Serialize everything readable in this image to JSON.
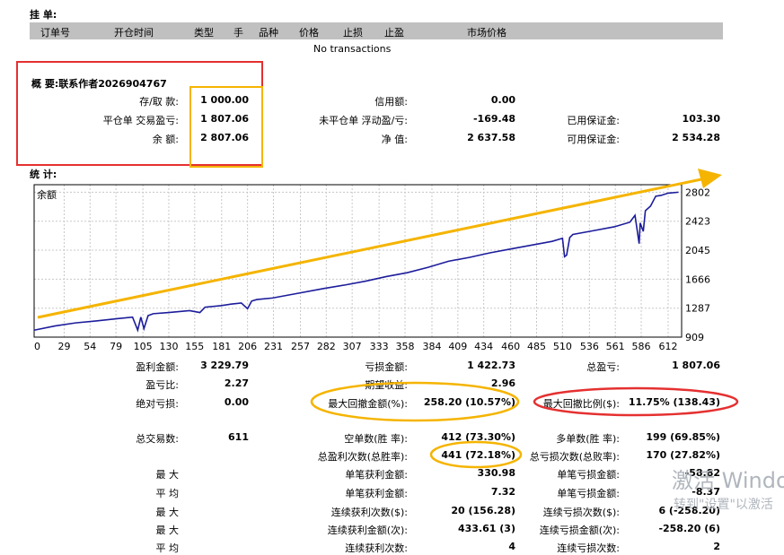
{
  "pending": {
    "title": "挂 单:",
    "columns": [
      "订单号",
      "开仓时间",
      "类型",
      "手",
      "品种",
      "价格",
      "止损",
      "止盈",
      "市场价格"
    ],
    "empty": "No transactions"
  },
  "summary": {
    "title": "概 要:联系作者2026904767",
    "rows": [
      [
        [
          "存/取 款:",
          "1 000.00"
        ],
        [
          "信用额:",
          "0.00"
        ],
        [
          "",
          ""
        ]
      ],
      [
        [
          "平仓单 交易盈亏:",
          "1 807.06"
        ],
        [
          "未平仓单 浮动盈/亏:",
          "-169.48"
        ],
        [
          "已用保证金:",
          "103.30"
        ]
      ],
      [
        [
          "余 额:",
          "2 807.06"
        ],
        [
          "净 值:",
          "2 637.58"
        ],
        [
          "可用保证金:",
          "2 534.28"
        ]
      ]
    ]
  },
  "stats": {
    "title": "统 计:",
    "rows": [
      [
        [
          "盈利金额:",
          "3 229.79"
        ],
        [
          "亏损金额:",
          "1 422.73"
        ],
        [
          "总盈亏:",
          "1 807.06"
        ]
      ],
      [
        [
          "盈亏比:",
          "2.27"
        ],
        [
          "期望收益:",
          "2.96"
        ],
        [
          "",
          ""
        ]
      ],
      [
        [
          "绝对亏损:",
          "0.00"
        ],
        [
          "最大回撤金额(%):",
          "258.20 (10.57%)"
        ],
        [
          "最大回撤比例($):",
          "11.75% (138.43)"
        ]
      ],
      [
        [
          "总交易数:",
          "611"
        ],
        [
          "空单数(胜 率):",
          "412 (73.30%)"
        ],
        [
          "多单数(胜 率):",
          "199 (69.85%)"
        ]
      ],
      [
        [
          "",
          ""
        ],
        [
          "总盈利次数(总胜率):",
          "441 (72.18%)"
        ],
        [
          "总亏损次数(总败率):",
          "170 (27.82%)"
        ]
      ],
      [
        [
          "最 大",
          ""
        ],
        [
          "单笔获利金额:",
          "330.98"
        ],
        [
          "单笔亏损金额:",
          "-58.82"
        ]
      ],
      [
        [
          "平 均",
          ""
        ],
        [
          "单笔获利金额:",
          "7.32"
        ],
        [
          "单笔亏损金额:",
          "-8.37"
        ]
      ],
      [
        [
          "最 大",
          ""
        ],
        [
          "连续获利次数($):",
          "20 (156.28)"
        ],
        [
          "连续亏损次数($):",
          "6 (-258.20)"
        ]
      ],
      [
        [
          "最 大",
          ""
        ],
        [
          "连续获利金额(次):",
          "433.61 (3)"
        ],
        [
          "连续亏损金额(次):",
          "-258.20 (6)"
        ]
      ],
      [
        [
          "平 均",
          ""
        ],
        [
          "连续获利次数:",
          "4"
        ],
        [
          "连续亏损次数:",
          "2"
        ]
      ]
    ]
  },
  "watermark": {
    "line1": "激活 Windo",
    "line2": "转到\"设置\"以激活"
  },
  "colors": {
    "highlight_red": "#e53030",
    "highlight_orange": "#f5b400",
    "balance_line": "#1c1c9c",
    "grid": "#c8c8c8"
  },
  "chart_data": {
    "type": "line",
    "title": "余额",
    "x_ticks": [
      "0",
      "29",
      "54",
      "79",
      "105",
      "130",
      "155",
      "181",
      "206",
      "231",
      "257",
      "282",
      "307",
      "333",
      "358",
      "384",
      "409",
      "434",
      "460",
      "485",
      "510",
      "536",
      "561",
      "586",
      "612"
    ],
    "y_ticks": [
      "2802",
      "2423",
      "2045",
      "1666",
      "1287",
      "909"
    ],
    "xlim": [
      0,
      625
    ],
    "ylim": [
      909,
      2900
    ],
    "grid": true,
    "series": [
      {
        "x": [
          0,
          20,
          40,
          60,
          80,
          95,
          100,
          103,
          106,
          110,
          115,
          130,
          150,
          160,
          165,
          180,
          190,
          200,
          206,
          210,
          215,
          230,
          250,
          280,
          300,
          320,
          340,
          360,
          380,
          400,
          420,
          440,
          460,
          480,
          500,
          510,
          512,
          514,
          517,
          520,
          540,
          560,
          575,
          580,
          584,
          585,
          588,
          590,
          595,
          600,
          605,
          612,
          622
        ],
        "y": [
          1000,
          1055,
          1095,
          1120,
          1150,
          1170,
          1000,
          1170,
          1020,
          1190,
          1215,
          1230,
          1255,
          1230,
          1300,
          1320,
          1340,
          1355,
          1280,
          1380,
          1400,
          1420,
          1470,
          1545,
          1590,
          1640,
          1700,
          1750,
          1820,
          1900,
          1950,
          2010,
          2060,
          2110,
          2160,
          2200,
          1960,
          1980,
          2210,
          2250,
          2300,
          2350,
          2410,
          2500,
          2130,
          2400,
          2290,
          2560,
          2620,
          2750,
          2760,
          2790,
          2802
        ]
      }
    ]
  }
}
